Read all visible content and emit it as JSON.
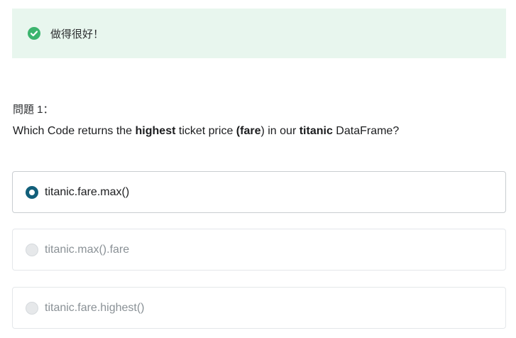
{
  "feedback": {
    "message": "做得很好！",
    "icon": "check-circle-icon",
    "color": "#3cb46e",
    "background": "#e8f6ee"
  },
  "question": {
    "number_label": "問題 1：",
    "text_parts": [
      "Which Code returns the ",
      "highest",
      " ticket price ",
      "(fare",
      ") in our ",
      "titanic",
      " DataFrame?"
    ]
  },
  "options": [
    {
      "label": "titanic.fare.max()",
      "selected": true
    },
    {
      "label": "titanic.max().fare",
      "selected": false
    },
    {
      "label": "titanic.fare.highest()",
      "selected": false
    }
  ],
  "colors": {
    "radio_selected": "#125f7a",
    "text_muted": "#8a9196"
  }
}
